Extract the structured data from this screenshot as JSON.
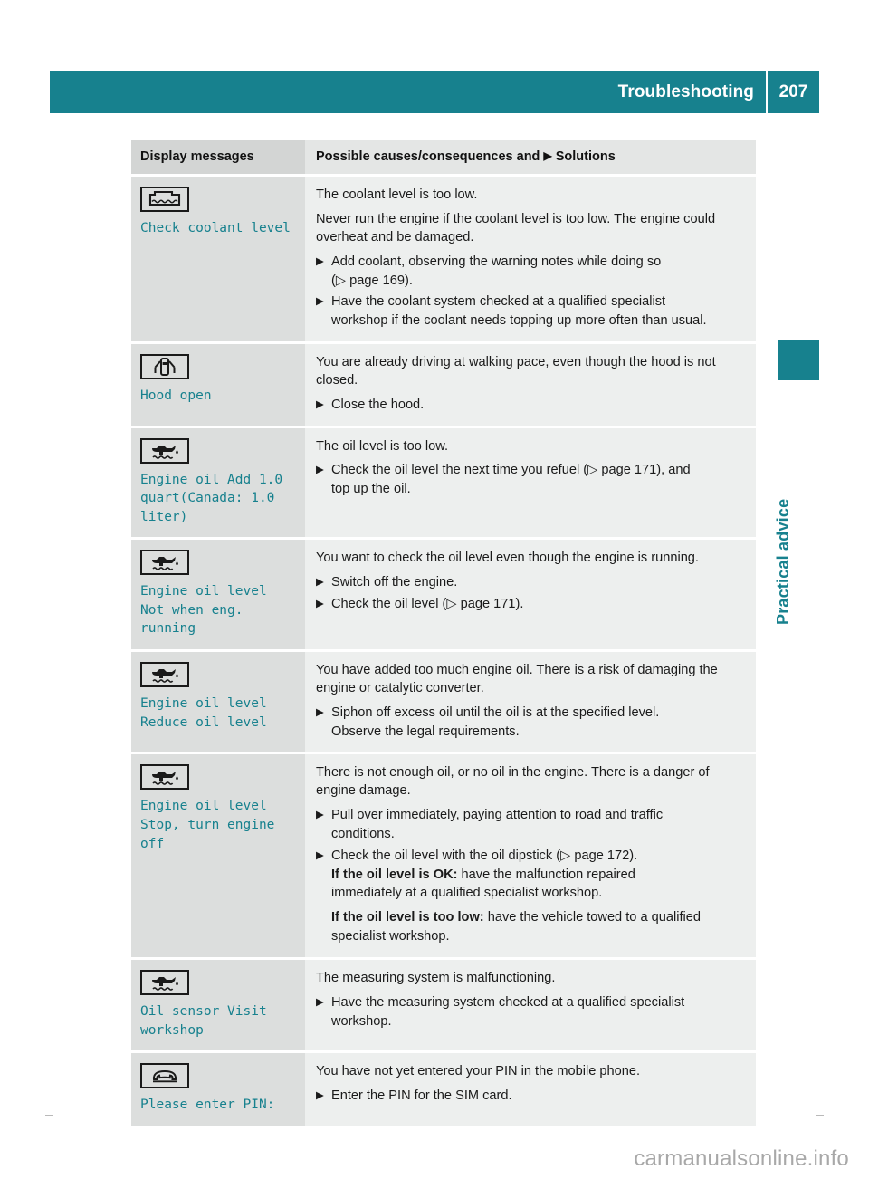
{
  "header": {
    "title": "Troubleshooting",
    "page_number": "207",
    "bar_color": "#17818e"
  },
  "side": {
    "section_label": "Practical advice",
    "tab_color": "#17818e"
  },
  "table": {
    "columns": {
      "left": "Display messages",
      "right_before_arrow": "Possible causes/consequences and ",
      "right_arrow": "▶",
      "right_after_arrow": " Solutions"
    },
    "rows": [
      {
        "icon": "coolant-level-icon",
        "message": "Check coolant level",
        "cause_1": "The coolant level is too low.",
        "cause_2": "Never run the engine if the coolant level is too low. The engine could overheat and be damaged.",
        "step_1_a": "Add coolant, observing the warning notes while doing so",
        "step_1_b": "(▷ page 169).",
        "step_2_a": "Have the coolant system checked at a qualified specialist",
        "step_2_b": "workshop if the coolant needs topping up more often than usual."
      },
      {
        "icon": "hood-open-icon",
        "message": "Hood open",
        "cause_1": "You are already driving at walking pace, even though the hood is not closed.",
        "step_1": "Close the hood."
      },
      {
        "icon": "engine-oil-icon",
        "message": "Engine oil Add 1.0\nquart(Canada: 1.0\nliter)",
        "cause_1": "The oil level is too low.",
        "step_1_a": "Check the oil level the next time you refuel (▷ page 171), and",
        "step_1_b": "top up the oil."
      },
      {
        "icon": "engine-oil-icon",
        "message": "Engine oil level\nNot when eng.\nrunning",
        "cause_1": "You want to check the oil level even though the engine is running.",
        "step_1": "Switch off the engine.",
        "step_2": "Check the oil level (▷ page 171)."
      },
      {
        "icon": "engine-oil-icon",
        "message": "Engine oil level\nReduce oil level",
        "cause_1": "You have added too much engine oil. There is a risk of damaging the engine or catalytic converter.",
        "step_1_a": "Siphon off excess oil until the oil is at the specified level.",
        "step_1_b": "Observe the legal requirements."
      },
      {
        "icon": "engine-oil-icon",
        "message": "Engine oil level\nStop, turn engine\noff",
        "cause_1": "There is not enough oil, or no oil in the engine. There is a danger of engine damage.",
        "step_1_a": "Pull over immediately, paying attention to road and traffic",
        "step_1_b": "conditions.",
        "step_2_a": "Check the oil level with the oil dipstick (▷ page 172).",
        "step_2_bold_1": "If the oil level is OK:",
        "step_2_rest_1": " have the malfunction repaired",
        "step_2_cont_1": "immediately at a qualified specialist workshop.",
        "step_2_bold_2": "If the oil level is too low:",
        "step_2_rest_2": " have the vehicle towed to a qualified",
        "step_2_cont_2": "specialist workshop."
      },
      {
        "icon": "engine-oil-icon",
        "message": "Oil sensor Visit\nworkshop",
        "cause_1": "The measuring system is malfunctioning.",
        "step_1_a": "Have the measuring system checked at a qualified specialist",
        "step_1_b": "workshop."
      },
      {
        "icon": "telephone-icon",
        "message": "Please enter PIN:",
        "cause_1": "You have not yet entered your PIN in the mobile phone.",
        "step_1": "Enter the PIN for the SIM card."
      }
    ]
  },
  "watermark": "carmanualsonline.info"
}
